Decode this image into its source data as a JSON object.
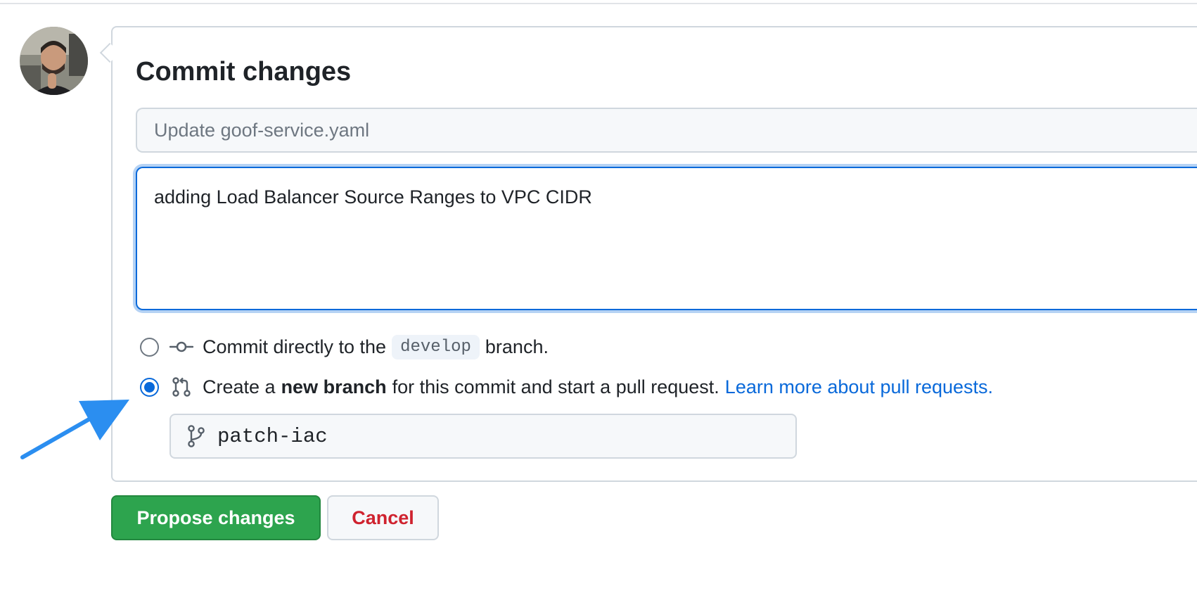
{
  "panel": {
    "title": "Commit changes",
    "summary_placeholder": "Update goof-service.yaml",
    "summary_value": "",
    "description_value": "adding Load Balancer Source Ranges to VPC CIDR"
  },
  "options": {
    "direct": {
      "text_before": "Commit directly to the",
      "branch": "develop",
      "text_after": "branch.",
      "checked": false
    },
    "new_branch": {
      "text_before": "Create a",
      "bold": "new branch",
      "text_after": "for this commit and start a pull request.",
      "link": "Learn more about pull requests.",
      "checked": true
    }
  },
  "branch_name_value": "patch-iac",
  "buttons": {
    "propose": "Propose changes",
    "cancel": "Cancel"
  },
  "colors": {
    "accent": "#0969da",
    "primary_button": "#2da44e",
    "danger_text": "#cf222e",
    "annotation_arrow": "#2b8ef0"
  },
  "icons": {
    "commit": "git-commit-icon",
    "pull_request": "git-pull-request-icon",
    "branch": "git-branch-icon"
  }
}
